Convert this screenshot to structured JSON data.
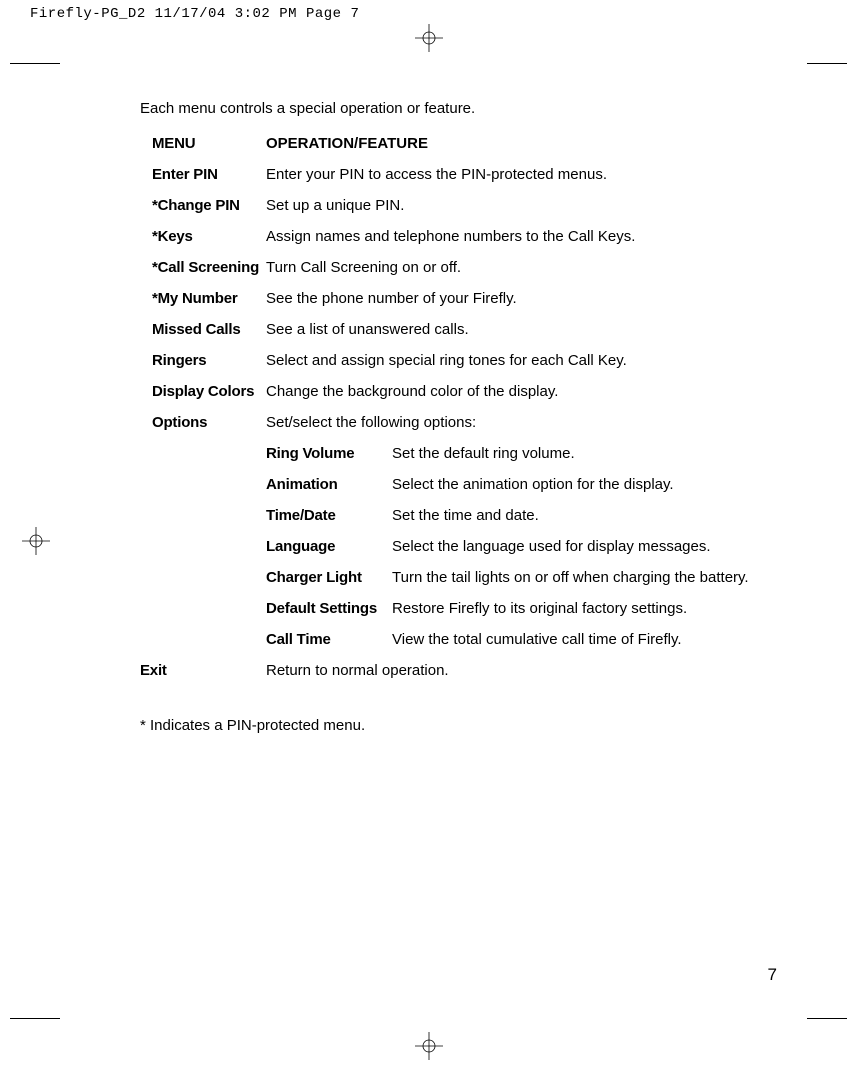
{
  "slug": "Firefly-PG_D2  11/17/04  3:02 PM  Page 7",
  "intro": "Each menu controls a special operation or feature.",
  "header": {
    "menu": "MENU",
    "desc": "OPERATION/FEATURE"
  },
  "rows": [
    {
      "menu": "Enter PIN",
      "desc": "Enter your PIN to access the PIN-protected menus."
    },
    {
      "menu": "*Change PIN",
      "desc": "Set up a unique PIN."
    },
    {
      "menu": "*Keys",
      "desc": "Assign names and telephone numbers to the Call Keys."
    },
    {
      "menu": "*Call Screening",
      "desc": "Turn Call Screening on or off."
    },
    {
      "menu": "*My Number",
      "desc": "See the phone number of your Firefly."
    },
    {
      "menu": "Missed Calls",
      "desc": "See a list of unanswered calls."
    },
    {
      "menu": "Ringers",
      "desc": "Select and assign special ring tones for each Call Key."
    },
    {
      "menu": "Display Colors",
      "desc": "Change the background color of the display."
    },
    {
      "menu": "Options",
      "desc": "Set/select the following options:"
    }
  ],
  "options_sub": [
    {
      "menu": "Ring Volume",
      "desc": "Set the default ring volume."
    },
    {
      "menu": "Animation",
      "desc": "Select the animation option for the display."
    },
    {
      "menu": "Time/Date",
      "desc": "Set the time and date."
    },
    {
      "menu": "Language",
      "desc": "Select the language used for display messages."
    },
    {
      "menu": "Charger Light",
      "desc": "Turn the tail lights on or off when charging the battery."
    },
    {
      "menu": "Default Settings",
      "desc": "Restore Firefly to its original factory settings."
    },
    {
      "menu": "Call Time",
      "desc": "View the total cumulative call time of Firefly."
    }
  ],
  "exit": {
    "menu": "Exit",
    "desc": "Return to normal operation."
  },
  "footnote": "* Indicates a PIN-protected menu.",
  "page_number": "7"
}
